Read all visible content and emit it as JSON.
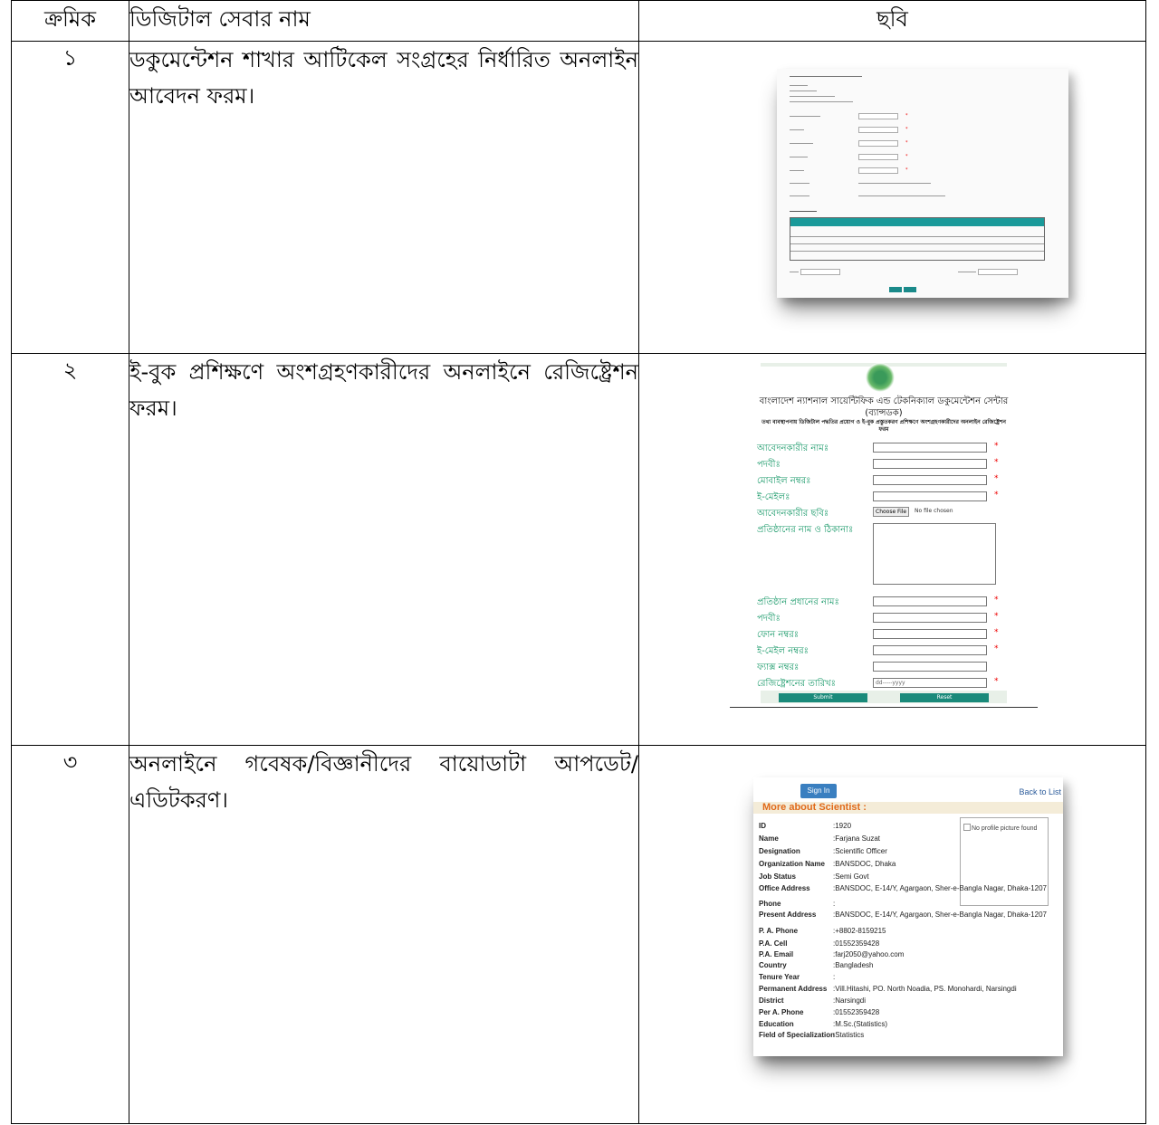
{
  "headers": [
    "ক্রমিক",
    "ডিজিটাল সেবার নাম",
    "ছবি"
  ],
  "rows": [
    {
      "num": "১",
      "text": "ডকুমেন্টেশন শাখার আটিকেল সংগ্রহের নির্ধারিত অনলাইন আবেদন ফরম।"
    },
    {
      "num": "২",
      "text": "ই-বুক প্রশিক্ষণে অংশগ্রহণকারীদের অনলাইনে রেজিষ্ট্রেশন ফরম।"
    },
    {
      "num": "৩",
      "text": "অনলাইনে গবেষক/বিজ্ঞানীদের বায়োডাটা আপডেট/ এডিটকরণ।"
    }
  ],
  "form2": {
    "org_title": "বাংলাদেশ ন্যাশনাল সায়েন্টিফিক এন্ড টেকনিক্যাল ডকুমেন্টেশন সেন্টার",
    "org_abbr": "(ব্যান্সডক)",
    "subtitle": "তথ্য ব্যবস্থাপনায় ডিজিটাল পদ্ধতির প্রয়োগ ও ই-বুক প্রস্তুতকরণ প্রশিক্ষণে অংশগ্রহণকারীদের অনলাইন রেজিষ্ট্রেশন ফরম",
    "fields": [
      "আবেদনকারীর নামঃ",
      "পদবীঃ",
      "মোবাইল নম্বরঃ",
      "ই-মেইলঃ",
      "আবেদনকারীর ছবিঃ",
      "প্রতিষ্ঠানের নাম ও ঠিকানাঃ",
      "প্রতিষ্ঠান প্রধানের নামঃ",
      "পদবীঃ",
      "ফোন নম্বরঃ",
      "ই-মেইল নম্বরঃ",
      "ফ্যাক্স নম্বরঃ",
      "রেজিষ্ট্রেশনের তারিখঃ"
    ],
    "choose_file": "Choose File",
    "no_file": "No file chosen",
    "date_placeholder": "dd-----yyyy",
    "submit": "Submit",
    "reset": "Reset"
  },
  "profile": {
    "sign_in": "Sign In",
    "back": "Back to List",
    "heading": "More about Scientist :",
    "no_pic": "No profile picture found",
    "fields": [
      [
        "ID",
        ":1920"
      ],
      [
        "Name",
        ":Farjana Suzat"
      ],
      [
        "Designation",
        ":Scientific Officer"
      ],
      [
        "Organization Name",
        ":BANSDOC, Dhaka"
      ],
      [
        "Job Status",
        ":Semi Govt"
      ],
      [
        "Office Address",
        ":BANSDOC, E-14/Y, Agargaon, Sher-e-Bangla Nagar, Dhaka-1207"
      ],
      [
        "Phone",
        ":"
      ],
      [
        "Present Address",
        ":BANSDOC, E-14/Y, Agargaon, Sher-e-Bangla Nagar, Dhaka-1207"
      ],
      [
        "P. A. Phone",
        ":+8802-8159215"
      ],
      [
        "P.A. Cell",
        ":01552359428"
      ],
      [
        "P.A. Email",
        ":farj2050@yahoo.com"
      ],
      [
        "Country",
        ":Bangladesh"
      ],
      [
        "Tenure Year",
        ":"
      ],
      [
        "Permanent Address",
        ":Vill.Hitashi, PO. North Noadia, PS. Monohardi, Narsingdi"
      ],
      [
        "District",
        ":Narsingdi"
      ],
      [
        "Per A. Phone",
        ":01552359428"
      ],
      [
        "Education",
        ":M.Sc.(Statistics)"
      ],
      [
        "Field of Specialization",
        ":Statistics"
      ]
    ]
  },
  "colors": {
    "teal": "#1a9a9a",
    "label_green": "#1a9a6a",
    "sign_in_blue": "#3a7fc0",
    "heading_orange": "#e06a1a"
  }
}
